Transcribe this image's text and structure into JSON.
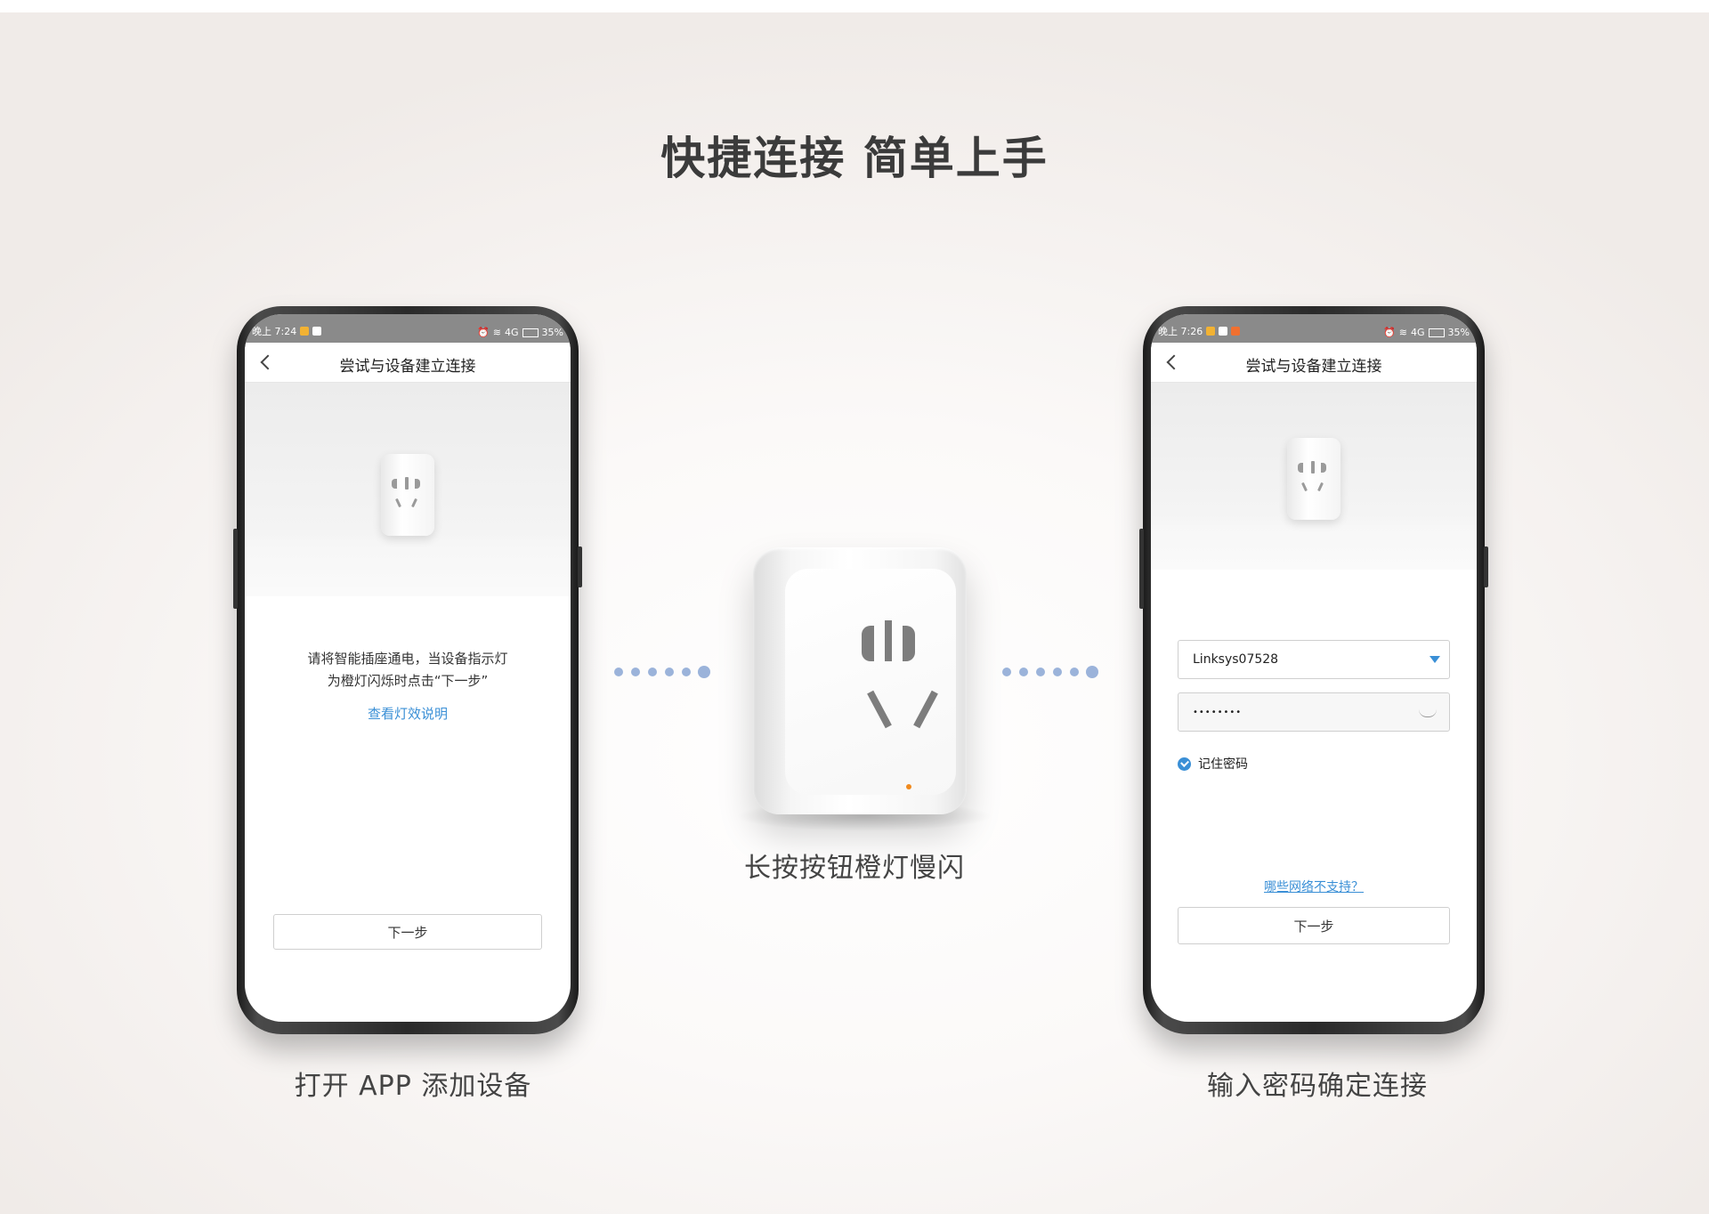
{
  "page": {
    "title": "快捷连接 简单上手",
    "center_caption": "长按按钮橙灯慢闪"
  },
  "phone_left": {
    "status": {
      "time": "晚上 7:24",
      "network": "4G",
      "battery": "35%"
    },
    "nav_title": "尝试与设备建立连接",
    "instruction_line1": "请将智能插座通电，当设备指示灯",
    "instruction_line2": "为橙灯闪烁时点击“下一步”",
    "light_help_link": "查看灯效说明",
    "next_button": "下一步",
    "caption": "打开 APP 添加设备"
  },
  "phone_right": {
    "status": {
      "time": "晚上 7:26",
      "network": "4G",
      "battery": "35%"
    },
    "nav_title": "尝试与设备建立连接",
    "wifi_ssid": "Linksys07528",
    "password_masked": "••••••••",
    "remember_password": "记住密码",
    "unsupported_link": "哪些网络不支持？",
    "next_button": "下一步",
    "caption": "输入密码确定连接"
  },
  "colors": {
    "accent": "#3a8fd6",
    "led": "#f08a1e",
    "dots": "#9bb3da"
  }
}
